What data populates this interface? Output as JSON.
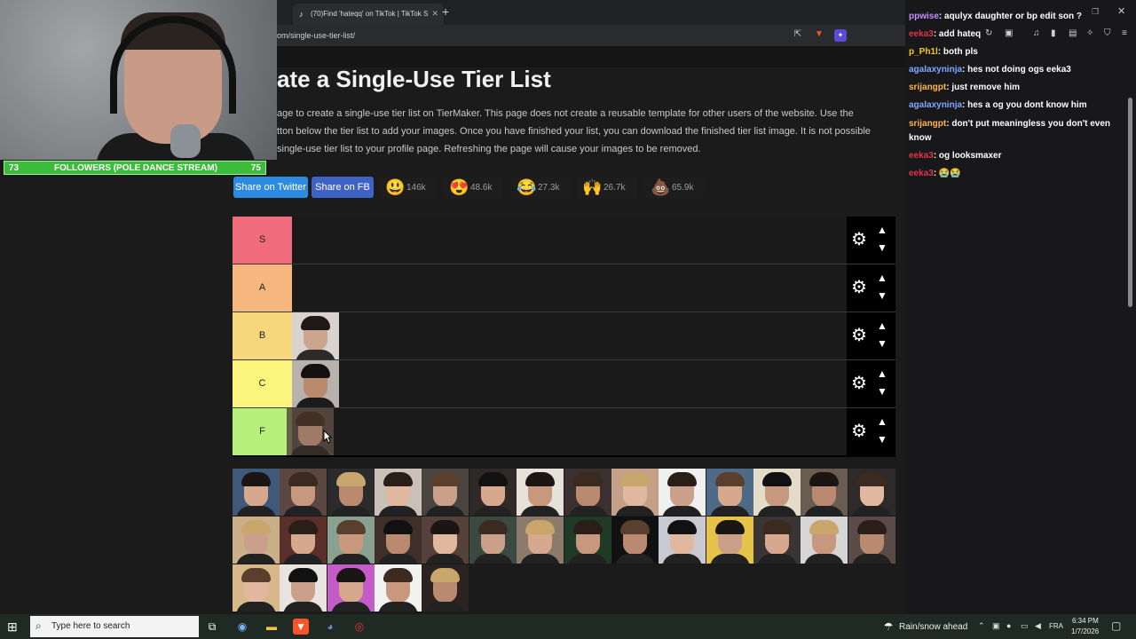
{
  "browser": {
    "tabs": [
      {
        "label": "(70)Find 'hateqq' on TikTok | TikTok S"
      }
    ],
    "url": "om/single-use-tier-list/"
  },
  "overlay": {
    "followers": {
      "current": "73",
      "label": "FOLLOWERS (POLE DANCE STREAM)",
      "goal": "75",
      "progress": 0.97
    }
  },
  "page": {
    "title": "ate a Single-Use Tier List",
    "description": [
      "age to create a single-use tier list on TierMaker. This page does not create a reusable template for other users of the website. Use the",
      "tton below the tier list to add your images. Once you have finished your list, you can download the finished tier list image. It is not possible",
      "single-use tier list to your profile page. Refreshing the page will cause your images to be removed."
    ],
    "share": {
      "twitter": "Share on Twitter",
      "facebook": "Share on FB"
    },
    "reactions": [
      {
        "emoji": "😃",
        "count": "146k"
      },
      {
        "emoji": "😍",
        "count": "48.6k"
      },
      {
        "emoji": "😂",
        "count": "27.3k"
      },
      {
        "emoji": "🙌",
        "count": "26.7k"
      },
      {
        "emoji": "💩",
        "count": "65.9k"
      }
    ]
  },
  "tiers": [
    {
      "label": "S",
      "color": "#f06b7c",
      "items": 0
    },
    {
      "label": "A",
      "color": "#f6b77f",
      "items": 0
    },
    {
      "label": "B",
      "color": "#f7d77c",
      "items": 1
    },
    {
      "label": "C",
      "color": "#fbf57d",
      "items": 1
    },
    {
      "label": "F",
      "color": "#b8f07c",
      "items": 1
    }
  ],
  "unranked_pool": {
    "count": 33
  },
  "chat": {
    "messages": [
      {
        "user": "ppwise",
        "color": "#c78cff",
        "text": "aqulyx daughter or bp edit son ?"
      },
      {
        "user": "eeka3",
        "color": "#e1344a",
        "text": "add hateq"
      },
      {
        "user": "p_Ph1l",
        "color": "#f7c81f",
        "text": "both pls"
      },
      {
        "user": "agalaxyninja",
        "color": "#7fa9ff",
        "text": "hes not doing ogs eeka3"
      },
      {
        "user": "srijangpt",
        "color": "#ffb545",
        "text": "just remove him"
      },
      {
        "user": "agalaxyninja",
        "color": "#7fa9ff",
        "text": "hes a og you dont know him"
      },
      {
        "user": "srijangpt",
        "color": "#ffb545",
        "text": "don't put meaningless you don't even know"
      },
      {
        "user": "eeka3",
        "color": "#e1344a",
        "text": "og looksmaxer"
      },
      {
        "user": "eeka3",
        "color": "#e1344a",
        "text": "😭😭"
      }
    ]
  },
  "taskbar": {
    "search_placeholder": "Type here to search",
    "weather": "Rain/snow ahead",
    "language": "FRA",
    "time": "6:34 PM",
    "date": "1/7/2026"
  }
}
